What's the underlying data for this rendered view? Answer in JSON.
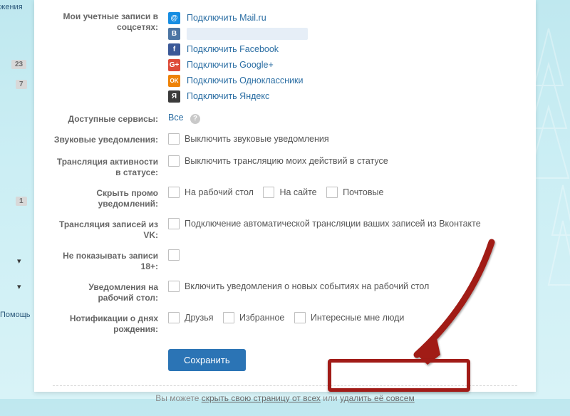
{
  "sidebar": {
    "top_link": "жения",
    "badges": [
      "23",
      "7"
    ],
    "single_badge": "1",
    "help_label": "Помощь"
  },
  "labels": {
    "accounts": "Мои учетные записи в соцсетях:",
    "services": "Доступные сервисы:",
    "sound": "Звуковые уведомления:",
    "activity": "Трансляция активности в статусе:",
    "hide_promo": "Скрыть промо уведомлений:",
    "vk_repost": "Трансляция записей из VK:",
    "adult": "Не показывать записи 18+:",
    "desktop": "Уведомления на рабочий стол:",
    "birthdays": "Нотификации о днях рождения:"
  },
  "social": {
    "mailru": {
      "label": "Подключить Mail.ru",
      "icon": "@",
      "bg": "#168de2"
    },
    "vk": {
      "label": "",
      "icon": "B",
      "bg": "#4c75a3"
    },
    "fb": {
      "label": "Подключить Facebook",
      "icon": "f",
      "bg": "#3b5998"
    },
    "gp": {
      "label": "Подключить Google+",
      "icon": "G+",
      "bg": "#dd4b39"
    },
    "ok": {
      "label": "Подключить Одноклассники",
      "icon": "OK",
      "bg": "#ee8208"
    },
    "ya": {
      "label": "Подключить Яндекс",
      "icon": "Я",
      "bg": "#3b3b3b"
    }
  },
  "services_value": "Все",
  "checkboxes": {
    "sound": "Выключить звуковые уведомления",
    "activity": "Выключить трансляцию моих действий в статусе",
    "promo_desktop": "На рабочий стол",
    "promo_site": "На сайте",
    "promo_mail": "Почтовые",
    "vk_repost": "Подключение автоматической трансляции ваших записей из Вконтакте",
    "desktop": "Включить уведомления о новых событиях на рабочий стол",
    "bd_friends": "Друзья",
    "bd_fav": "Избранное",
    "bd_interest": "Интересные мне люди"
  },
  "save_button": "Сохранить",
  "footer": {
    "prefix": "Вы можете ",
    "hide_link": "скрыть свою страницу от всех",
    "middle": " или ",
    "delete_link": "удалить её совсем"
  }
}
